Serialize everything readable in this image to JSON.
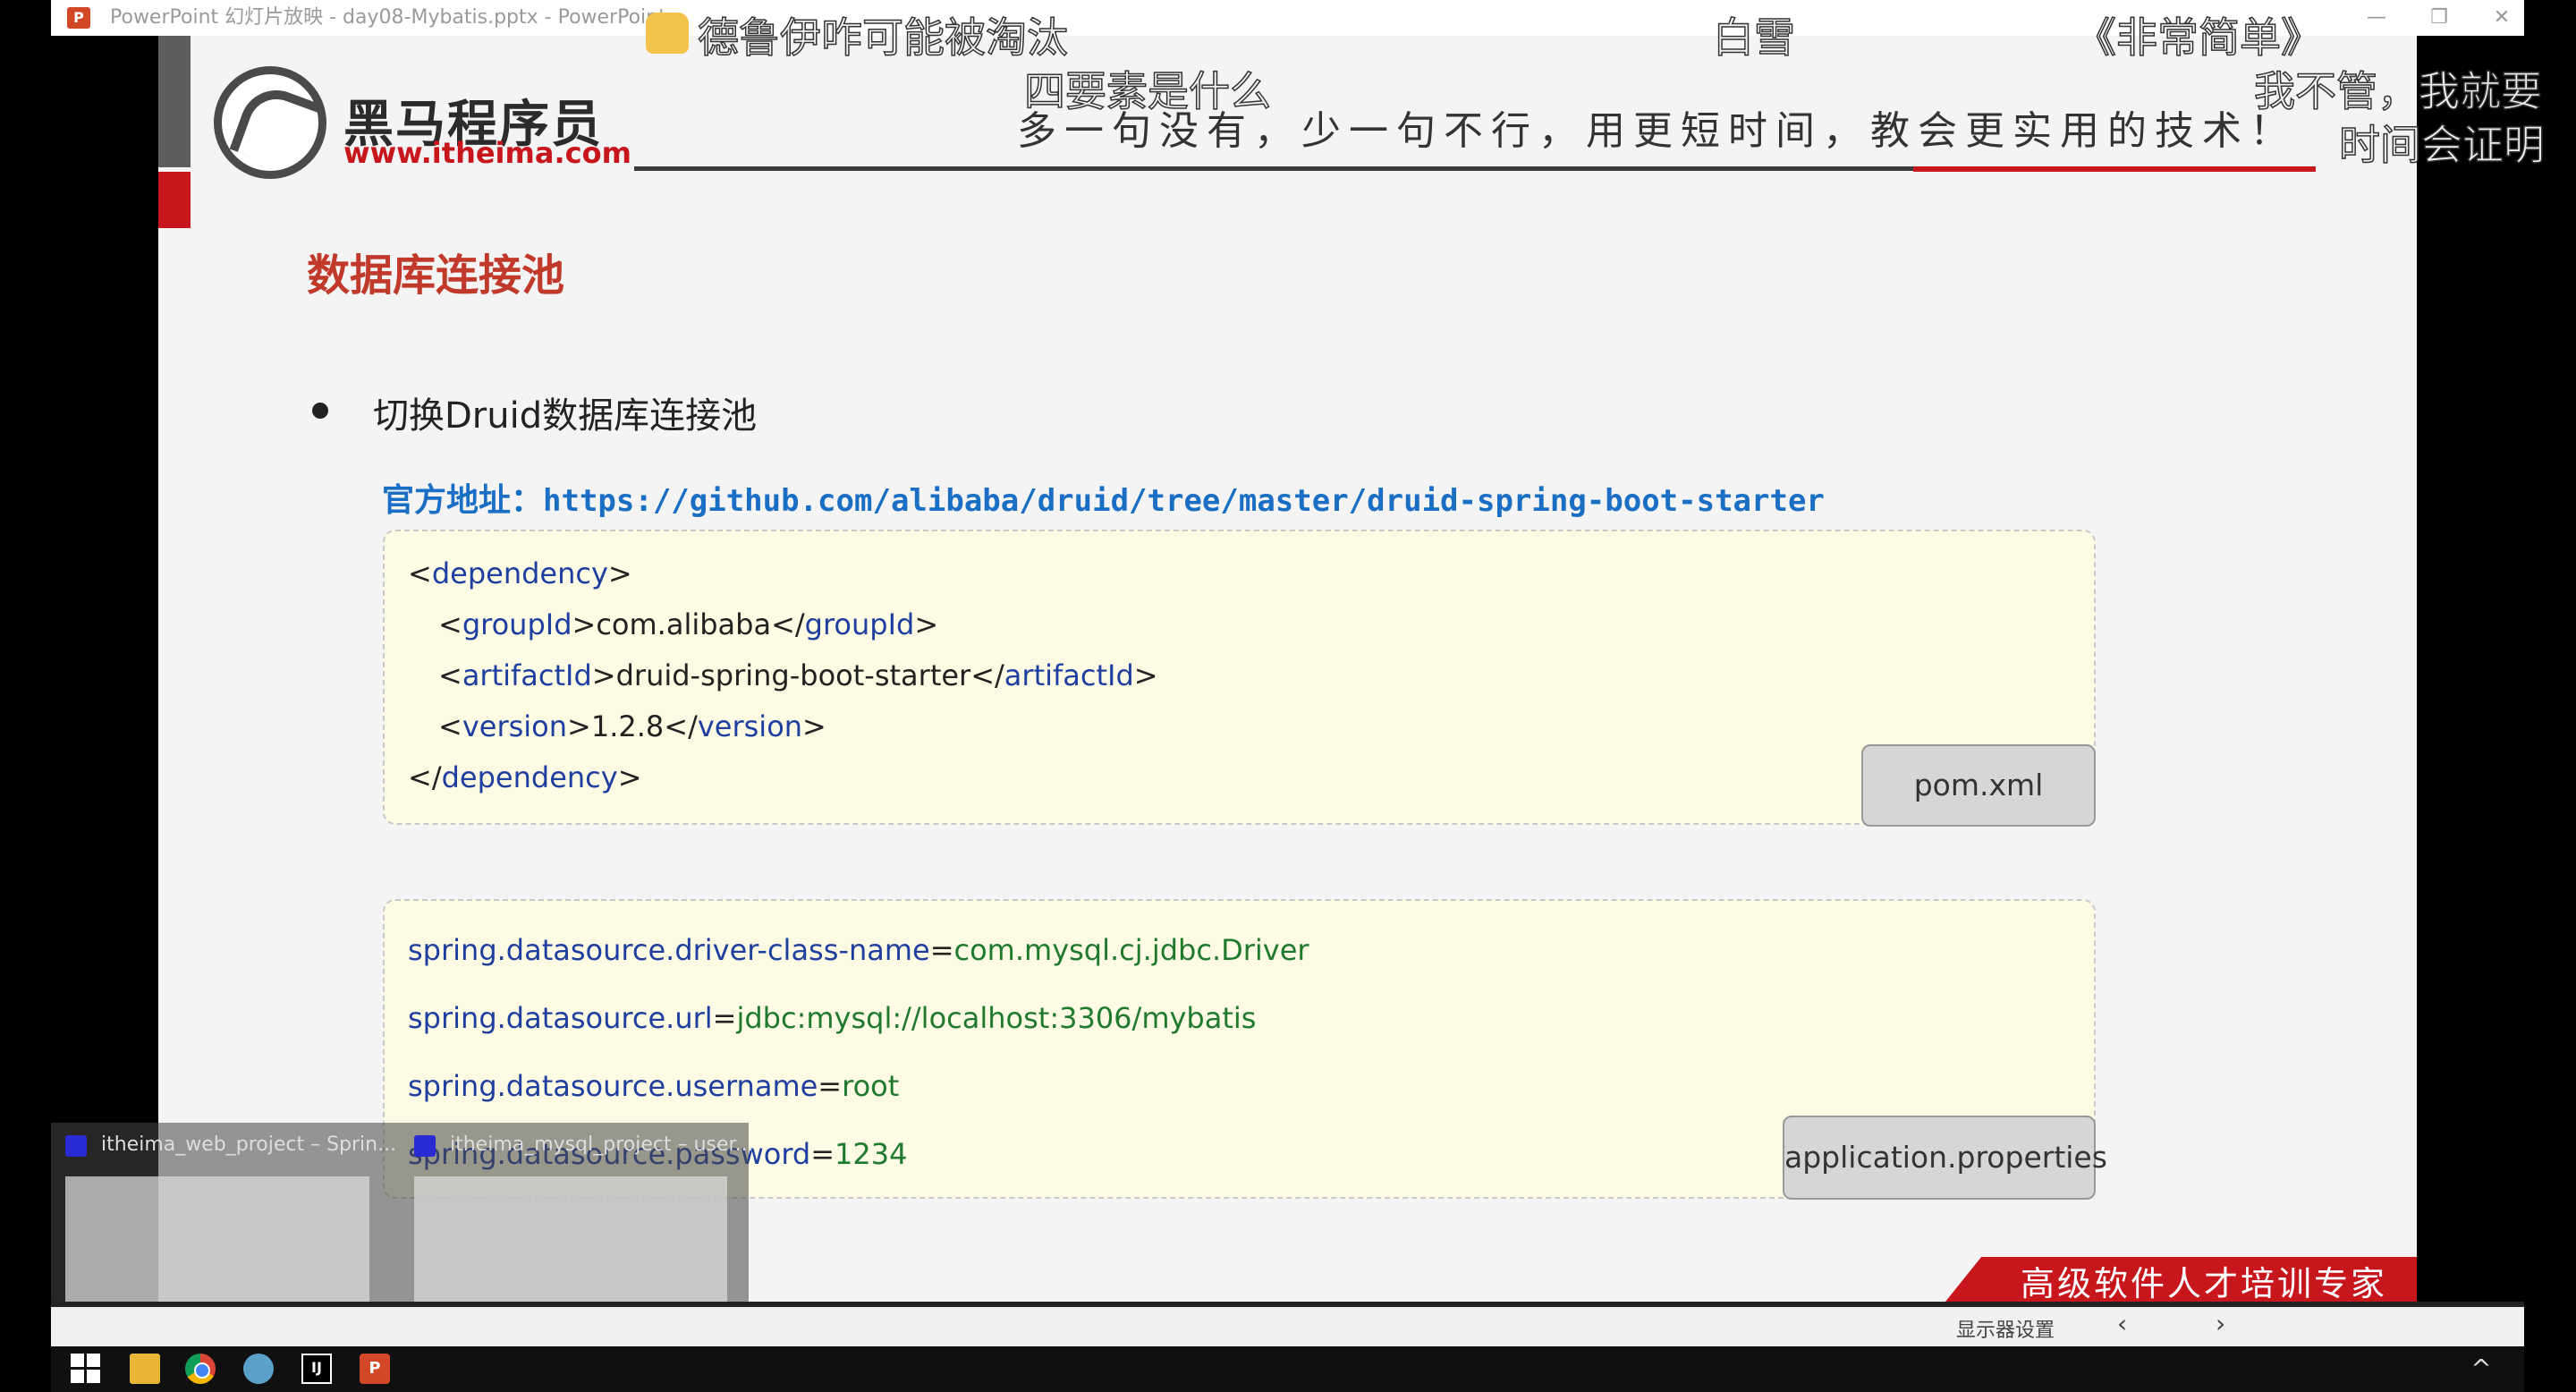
{
  "window": {
    "title": "PowerPoint 幻灯片放映  -  day08-Mybatis.pptx - PowerPoint",
    "app_icon_letter": "P",
    "minimize": "—",
    "restore": "❐",
    "close": "✕"
  },
  "danmaku": [
    "德鲁伊咋可能被淘汰",
    "白雪",
    "《非常简单》",
    "四要素是什么",
    "我不管，我就要",
    "时间会证明"
  ],
  "slide": {
    "logo_title": "黑马程序员",
    "logo_url": "www.itheima.com",
    "slogan": "多一句没有，少一句不行，用更短时间，教会更实用的技术！",
    "title": "数据库连接池",
    "bullet": "切换Druid数据库连接池",
    "url_label": "官方地址：",
    "url_value": "https://github.com/alibaba/druid/tree/master/druid-spring-boot-starter",
    "pom": {
      "open_dependency": "dependency",
      "groupId_tag": "groupId",
      "groupId_value": "com.alibaba",
      "artifactId_tag": "artifactId",
      "artifactId_value": "druid-spring-boot-starter",
      "version_tag": "version",
      "version_value": "1.2.8",
      "close_dependency": "dependency",
      "file_label": "pom.xml"
    },
    "properties": {
      "lines": [
        {
          "key": "spring.datasource.driver-class-name",
          "value": "com.mysql.cj.jdbc.Driver"
        },
        {
          "key": "spring.datasource.url",
          "value": "jdbc:mysql://localhost:3306/mybatis"
        },
        {
          "key": "spring.datasource.username",
          "value": "root"
        },
        {
          "key": "spring.datasource.password",
          "value": "1234"
        }
      ],
      "file_label": "application.properties"
    },
    "corner_banner": "高级软件人才培训专家"
  },
  "thumbnails": [
    {
      "title": "itheima_web_project – Sprin..."
    },
    {
      "title": "itheima_mysql_project – user..."
    }
  ],
  "presenter_bar": {
    "display_settings": "显示器设置",
    "prev": "‹",
    "next": "›"
  },
  "taskbar": {
    "idea_label": "IJ",
    "ppt_label": "P",
    "chevron": "^"
  },
  "colors": {
    "brand_red": "#c8161d",
    "title_red": "#c0392b",
    "url_blue": "#1a6fc4",
    "code_tag_blue": "#1f3fa0",
    "code_value_green": "#1f7a2e",
    "code_bg": "#fdfbe3"
  }
}
